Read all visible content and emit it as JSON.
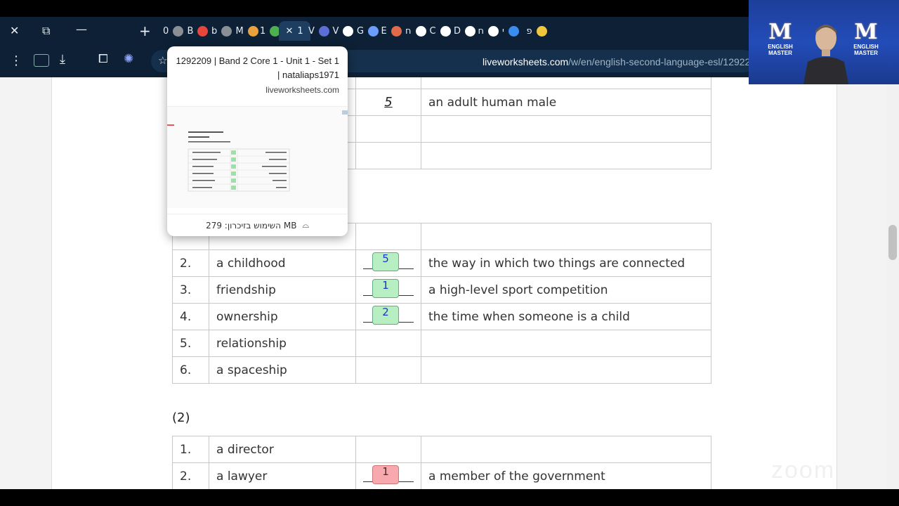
{
  "browser": {
    "tabs": [
      {
        "letter": "0",
        "fav_color": "#8a8f96"
      },
      {
        "letter": "B",
        "fav_color": "#e8453c"
      },
      {
        "letter": "b",
        "fav_color": "#8a8f96"
      },
      {
        "letter": "M",
        "fav_color": "#e8a13c"
      },
      {
        "letter": "1",
        "fav_color": "#4caf50"
      },
      {
        "letter": "1",
        "fav_color": "#ffffff",
        "active": true
      },
      {
        "letter": "V",
        "fav_color": "#5b6fd6"
      },
      {
        "letter": "V",
        "fav_color": "#ffffff"
      },
      {
        "letter": "G",
        "fav_color": "#6d9cff"
      },
      {
        "letter": "E",
        "fav_color": "#e06a4a"
      },
      {
        "letter": "ח",
        "fav_color": "#ffffff"
      },
      {
        "letter": "C",
        "fav_color": "#ffffff"
      },
      {
        "letter": "D",
        "fav_color": "#ffffff"
      },
      {
        "letter": "ח",
        "fav_color": "#ffffff"
      },
      {
        "letter": "י",
        "fav_color": "#3b8cf0"
      },
      {
        "letter": "פ",
        "fav_color": "#f0c63b"
      }
    ],
    "url_domain": "liveworksheets.com",
    "url_path": "/w/en/english-second-language-esl/12922"
  },
  "hover_card": {
    "title_line1": "1292209 | Band 2 Core 1 - Unit 1 - Set 1",
    "title_line2": "| nataliaps1971",
    "domain": "liveworksheets.com",
    "memory_text": "השימוש בזיכרון: 279 MB"
  },
  "worksheet": {
    "table1_rows": [
      {
        "answer": "5",
        "meaning": "an adult human male"
      },
      {
        "answer": "",
        "meaning": ""
      },
      {
        "answer": "",
        "meaning": ""
      }
    ],
    "table2_rows": [
      {
        "num": "2.",
        "word": "a childhood",
        "answer": "5",
        "meaning": "the way in which two things are connected"
      },
      {
        "num": "3.",
        "word": "friendship",
        "answer": "1",
        "meaning": "a high-level sport competition"
      },
      {
        "num": "4.",
        "word": "ownership",
        "answer": "2",
        "meaning": "the time when someone is a child"
      },
      {
        "num": "5.",
        "word": "relationship",
        "answer": "",
        "meaning": ""
      },
      {
        "num": "6.",
        "word": "a spaceship",
        "answer": "",
        "meaning": ""
      }
    ],
    "section2_label": "(2)",
    "table3_rows": [
      {
        "num": "1.",
        "word": "a director",
        "answer": "",
        "meaning": ""
      },
      {
        "num": "2.",
        "word": "a lawyer",
        "answer": "1",
        "meaning": "a member of the government"
      }
    ]
  },
  "webcam": {
    "logo_text_line1": "ENGLISH",
    "logo_text_line2": "MASTER"
  },
  "colors": {
    "chrome_bg": "#0d2035",
    "correct_answer": "#b8efc2",
    "wrong_answer": "#f7a9ad"
  }
}
